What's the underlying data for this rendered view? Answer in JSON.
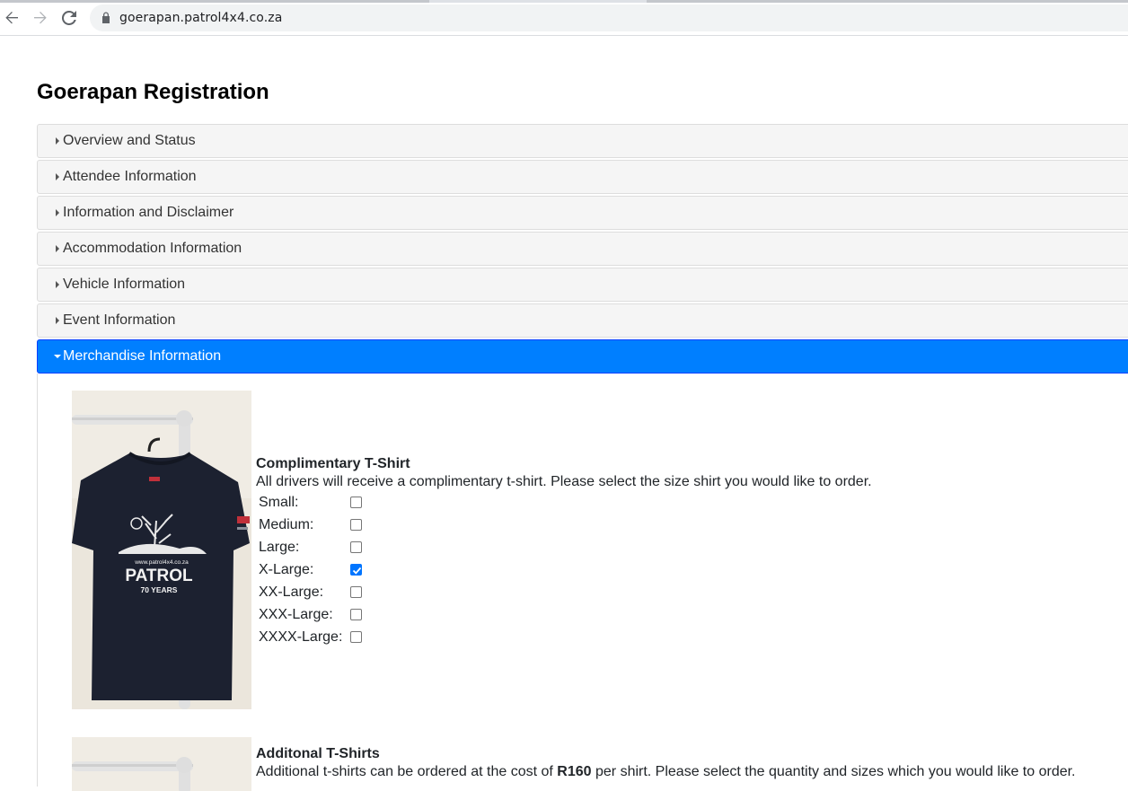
{
  "browser": {
    "url": "goerapan.patrol4x4.co.za",
    "icons": [
      "back-arrow-icon",
      "forward-arrow-icon",
      "reload-icon",
      "lock-icon"
    ]
  },
  "page": {
    "title": "Goerapan Registration"
  },
  "accordion": [
    {
      "label": "Overview and Status",
      "expanded": false
    },
    {
      "label": "Attendee Information",
      "expanded": false
    },
    {
      "label": "Information and Disclaimer",
      "expanded": false
    },
    {
      "label": "Accommodation Information",
      "expanded": false
    },
    {
      "label": "Vehicle Information",
      "expanded": false
    },
    {
      "label": "Event Information",
      "expanded": false
    },
    {
      "label": "Merchandise Information",
      "expanded": true
    }
  ],
  "colors": {
    "active_header": "#007fff",
    "header_bg": "#f5f5f5",
    "checkbox_checked": "#0075ff"
  },
  "merchandise": {
    "complimentary": {
      "title": "Complimentary T-Shirt",
      "description": "All drivers will receive a complimentary t-shirt. Please select the size shirt you would like to order.",
      "image_label": {
        "url": "www.patrol4x4.co.za",
        "brand": "PATROL",
        "years": "70 YEARS"
      },
      "sizes": [
        {
          "label": "Small:",
          "checked": false
        },
        {
          "label": "Medium:",
          "checked": false
        },
        {
          "label": "Large:",
          "checked": false
        },
        {
          "label": "X-Large:",
          "checked": true
        },
        {
          "label": "XX-Large:",
          "checked": false
        },
        {
          "label": "XXX-Large:",
          "checked": false
        },
        {
          "label": "XXXX-Large:",
          "checked": false
        }
      ]
    },
    "additional": {
      "title": "Additonal T-Shirts",
      "description_pre": "Additional t-shirts can be ordered at the cost of ",
      "price": "R160",
      "description_post": " per shirt. Please select the quantity and sizes which you would like to order."
    }
  }
}
